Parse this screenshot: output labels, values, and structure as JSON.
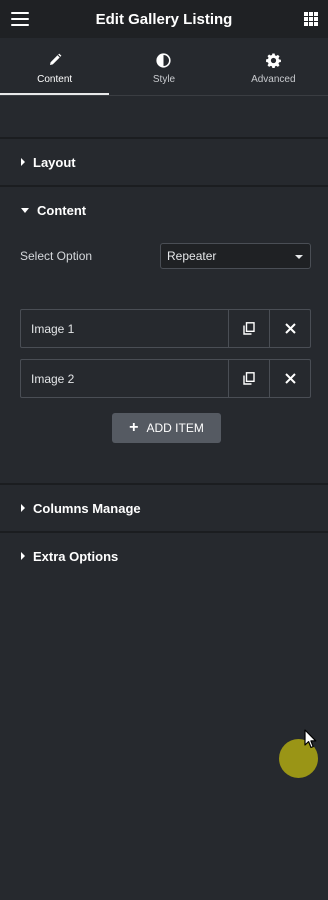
{
  "header": {
    "title": "Edit Gallery Listing",
    "menu_icon": "hamburger-icon",
    "apps_icon": "grid-icon"
  },
  "tabs": [
    {
      "label": "Content",
      "icon": "pencil-icon",
      "active": true
    },
    {
      "label": "Style",
      "icon": "half-circle-icon",
      "active": false
    },
    {
      "label": "Advanced",
      "icon": "gear-icon",
      "active": false
    }
  ],
  "sections": {
    "layout": "Layout",
    "content": "Content",
    "columns": "Columns Manage",
    "extra": "Extra Options"
  },
  "content": {
    "select_label": "Select Option",
    "select_value": "Repeater",
    "items": [
      "Image 1",
      "Image 2"
    ],
    "add_label": "ADD ITEM"
  },
  "colors": {
    "accent": "#e8e9ea",
    "background": "#26292e",
    "click_indicator": "#9a9516"
  }
}
